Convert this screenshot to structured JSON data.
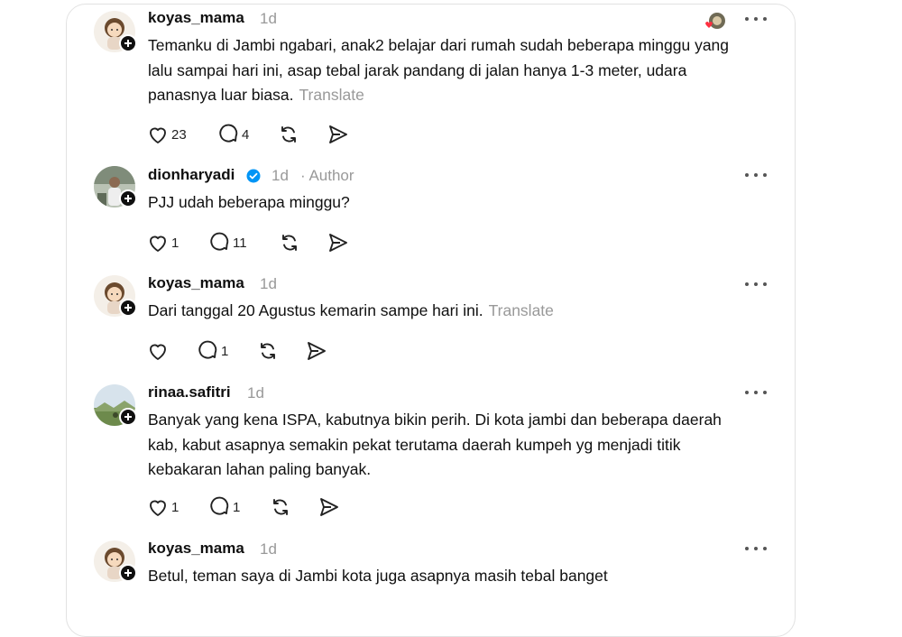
{
  "comments": [
    {
      "username": "koyas_mama",
      "time": "1d",
      "text": "Temanku di Jambi ngabari, anak2 belajar dari rumah sudah beberapa minggu yang lalu sampai hari ini, asap tebal jarak pandang di jalan hanya 1-3 meter, udara panasnya luar biasa.",
      "translate": "Translate",
      "likes": "23",
      "replies": "4"
    },
    {
      "username": "dionharyadi",
      "time": "1d",
      "author_tag": "· Author",
      "text": "PJJ udah beberapa minggu?",
      "likes": "1",
      "replies": "11"
    },
    {
      "username": "koyas_mama",
      "time": "1d",
      "text": "Dari tanggal 20 Agustus kemarin sampe hari ini.",
      "translate": "Translate",
      "likes": "",
      "replies": "1"
    },
    {
      "username": "rinaa.safitri",
      "time": "1d",
      "text": "Banyak yang kena ISPA, kabutnya bikin perih. Di kota jambi dan beberapa daerah kab, kabut asapnya semakin pekat terutama daerah kumpeh yg menjadi titik kebakaran lahan paling banyak.",
      "likes": "1",
      "replies": "1"
    },
    {
      "username": "koyas_mama",
      "time": "1d",
      "text": "Betul, teman saya di Jambi kota juga asapnya masih tebal banget"
    }
  ],
  "icons": {
    "like": "heart-icon",
    "reply": "comment-bubble-icon",
    "repost": "repost-icon",
    "share": "send-icon",
    "more": "more-dots-icon",
    "follow": "plus-icon",
    "verified": "verified-badge-icon"
  },
  "colors": {
    "verified": "#0095f6",
    "muted": "#999999",
    "reaction_heart": "#ff3040"
  }
}
